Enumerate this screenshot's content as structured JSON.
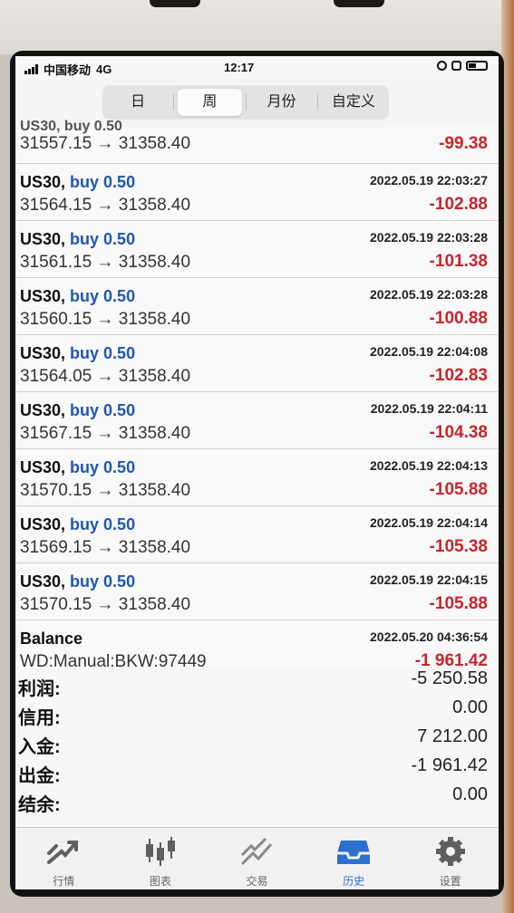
{
  "status_bar": {
    "carrier": "中国移动",
    "network": "4G",
    "time": "12:17"
  },
  "segments": [
    {
      "label": "日",
      "active": false
    },
    {
      "label": "周",
      "active": true
    },
    {
      "label": "月份",
      "active": false
    },
    {
      "label": "自定义",
      "active": false
    }
  ],
  "first_row": {
    "cut_text": "US30, buy 0.50",
    "prices": "31557.15 → 31358.40",
    "profit": "-99.38"
  },
  "trades": [
    {
      "symbol": "US30,",
      "side": "buy 0.50",
      "datetime": "2022.05.19 22:03:27",
      "prices": "31564.15 → 31358.40",
      "profit": "-102.88"
    },
    {
      "symbol": "US30,",
      "side": "buy 0.50",
      "datetime": "2022.05.19 22:03:28",
      "prices": "31561.15 → 31358.40",
      "profit": "-101.38"
    },
    {
      "symbol": "US30,",
      "side": "buy 0.50",
      "datetime": "2022.05.19 22:03:28",
      "prices": "31560.15 → 31358.40",
      "profit": "-100.88"
    },
    {
      "symbol": "US30,",
      "side": "buy 0.50",
      "datetime": "2022.05.19 22:04:08",
      "prices": "31564.05 → 31358.40",
      "profit": "-102.83"
    },
    {
      "symbol": "US30,",
      "side": "buy 0.50",
      "datetime": "2022.05.19 22:04:11",
      "prices": "31567.15 → 31358.40",
      "profit": "-104.38"
    },
    {
      "symbol": "US30,",
      "side": "buy 0.50",
      "datetime": "2022.05.19 22:04:13",
      "prices": "31570.15 → 31358.40",
      "profit": "-105.88"
    },
    {
      "symbol": "US30,",
      "side": "buy 0.50",
      "datetime": "2022.05.19 22:04:14",
      "prices": "31569.15 → 31358.40",
      "profit": "-105.38"
    },
    {
      "symbol": "US30,",
      "side": "buy 0.50",
      "datetime": "2022.05.19 22:04:15",
      "prices": "31570.15 → 31358.40",
      "profit": "-105.88"
    }
  ],
  "balance_row": {
    "title": "Balance",
    "datetime": "2022.05.20 04:36:54",
    "comment": "WD:Manual:BKW:97449",
    "amount": "-1 961.42"
  },
  "summary": [
    {
      "label": "利润:",
      "value": "-5 250.58"
    },
    {
      "label": "信用:",
      "value": "0.00"
    },
    {
      "label": "入金:",
      "value": "7 212.00"
    },
    {
      "label": "出金:",
      "value": "-1 961.42"
    },
    {
      "label": "结余:",
      "value": "0.00"
    }
  ],
  "tabs": [
    {
      "label": "行情",
      "icon": "quotes-icon",
      "active": false
    },
    {
      "label": "图表",
      "icon": "chart-icon",
      "active": false
    },
    {
      "label": "交易",
      "icon": "trade-icon",
      "active": false
    },
    {
      "label": "历史",
      "icon": "history-icon",
      "active": true
    },
    {
      "label": "设置",
      "icon": "settings-icon",
      "active": false
    }
  ],
  "colors": {
    "loss": "#c8252c",
    "side": "#1e56b4",
    "active_tab": "#2b6fd1"
  }
}
